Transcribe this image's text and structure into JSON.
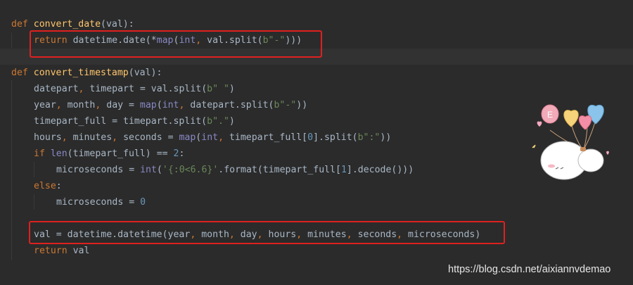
{
  "editor": {
    "theme": {
      "background": "#2b2b2b",
      "keyword": "#cc7832",
      "function_name": "#ffc66d",
      "string": "#6a8759",
      "number": "#6897bb",
      "builtin": "#8888c6",
      "plain": "#a9b7c6",
      "highlight_box": "#e02020"
    },
    "lines": [
      {
        "tokens": [
          [
            "kw",
            "def "
          ],
          [
            "fn",
            "convert_date"
          ],
          [
            "plain",
            "(val):"
          ]
        ]
      },
      {
        "tokens": [
          [
            "kw",
            "return "
          ],
          [
            "plain",
            "datetime.date(*"
          ],
          [
            "builtin",
            "map"
          ],
          [
            "plain",
            "("
          ],
          [
            "builtin",
            "int"
          ],
          [
            "kw",
            ", "
          ],
          [
            "plain",
            "val.split("
          ],
          [
            "str",
            "b\"-\""
          ],
          [
            "plain",
            ")))"
          ]
        ]
      },
      {
        "tokens": []
      },
      {
        "tokens": [
          [
            "kw",
            "def "
          ],
          [
            "fn",
            "convert_timestamp"
          ],
          [
            "plain",
            "(val):"
          ]
        ]
      },
      {
        "tokens": [
          [
            "plain",
            "datepart"
          ],
          [
            "kw",
            ", "
          ],
          [
            "plain",
            "timepart = val.split("
          ],
          [
            "str",
            "b\" \""
          ],
          [
            "plain",
            ")"
          ]
        ]
      },
      {
        "tokens": [
          [
            "plain",
            "year"
          ],
          [
            "kw",
            ", "
          ],
          [
            "plain",
            "month"
          ],
          [
            "kw",
            ", "
          ],
          [
            "plain",
            "day = "
          ],
          [
            "builtin",
            "map"
          ],
          [
            "plain",
            "("
          ],
          [
            "builtin",
            "int"
          ],
          [
            "kw",
            ", "
          ],
          [
            "plain",
            "datepart.split("
          ],
          [
            "str",
            "b\"-\""
          ],
          [
            "plain",
            "))"
          ]
        ]
      },
      {
        "tokens": [
          [
            "plain",
            "timepart_full = timepart.split("
          ],
          [
            "str",
            "b\".\""
          ],
          [
            "plain",
            ")"
          ]
        ]
      },
      {
        "tokens": [
          [
            "plain",
            "hours"
          ],
          [
            "kw",
            ", "
          ],
          [
            "plain",
            "minutes"
          ],
          [
            "kw",
            ", "
          ],
          [
            "plain",
            "seconds = "
          ],
          [
            "builtin",
            "map"
          ],
          [
            "plain",
            "("
          ],
          [
            "builtin",
            "int"
          ],
          [
            "kw",
            ", "
          ],
          [
            "plain",
            "timepart_full["
          ],
          [
            "num",
            "0"
          ],
          [
            "plain",
            "].split("
          ],
          [
            "str",
            "b\":\""
          ],
          [
            "plain",
            "))"
          ]
        ]
      },
      {
        "tokens": [
          [
            "kw",
            "if "
          ],
          [
            "builtin",
            "len"
          ],
          [
            "plain",
            "(timepart_full) == "
          ],
          [
            "num",
            "2"
          ],
          [
            "plain",
            ":"
          ]
        ]
      },
      {
        "tokens": [
          [
            "plain",
            "microseconds = "
          ],
          [
            "builtin",
            "int"
          ],
          [
            "plain",
            "("
          ],
          [
            "str",
            "'{:0<6.6}'"
          ],
          [
            "plain",
            ".format(timepart_full["
          ],
          [
            "num",
            "1"
          ],
          [
            "plain",
            "].decode()))"
          ]
        ]
      },
      {
        "tokens": [
          [
            "kw",
            "else"
          ],
          [
            "plain",
            ":"
          ]
        ]
      },
      {
        "tokens": [
          [
            "plain",
            "microseconds = "
          ],
          [
            "num",
            "0"
          ]
        ]
      },
      {
        "tokens": []
      },
      {
        "tokens": [
          [
            "plain",
            "val = datetime.datetime(year"
          ],
          [
            "kw",
            ", "
          ],
          [
            "plain",
            "month"
          ],
          [
            "kw",
            ", "
          ],
          [
            "plain",
            "day"
          ],
          [
            "kw",
            ", "
          ],
          [
            "plain",
            "hours"
          ],
          [
            "kw",
            ", "
          ],
          [
            "plain",
            "minutes"
          ],
          [
            "kw",
            ", "
          ],
          [
            "plain",
            "seconds"
          ],
          [
            "kw",
            ", "
          ],
          [
            "plain",
            "microseconds)"
          ]
        ]
      },
      {
        "tokens": [
          [
            "kw",
            "return "
          ],
          [
            "plain",
            "val"
          ]
        ]
      }
    ]
  },
  "watermark": {
    "text": "https://blog.csdn.net/aixiannvdemao"
  },
  "sticker": {
    "balloon_letter": "E",
    "icon": "balloon-character-sticker"
  }
}
